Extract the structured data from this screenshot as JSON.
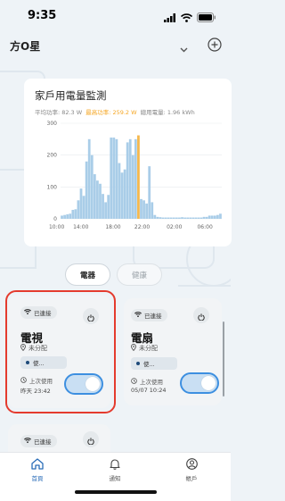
{
  "status_bar": {
    "time": "9:35"
  },
  "header": {
    "home_name": "方O星"
  },
  "chart_card": {
    "title": "家戶用電量監測",
    "avg_power_label": "平均功率:",
    "avg_power_value": "82.3 W",
    "peak_power_label": "最高功率:",
    "peak_power_value": "259.2 W",
    "total_label": "總用電量:",
    "total_value": "1.96 kWh"
  },
  "chart_data": {
    "type": "bar",
    "title": "家戶用電量監測",
    "xlabel": "",
    "ylabel": "",
    "ylim": [
      0,
      300
    ],
    "yticks": [
      "0",
      "100",
      "200",
      "300"
    ],
    "xticks": [
      "10:00",
      "14:00",
      "18:00",
      "22:00",
      "02:00",
      "06:00"
    ],
    "highlight_color": "#f5b84d",
    "bar_color": "#a9cde8",
    "highlight_index": 28,
    "values": [
      10,
      12,
      14,
      16,
      28,
      30,
      58,
      95,
      72,
      180,
      250,
      200,
      140,
      120,
      110,
      78,
      52,
      75,
      255,
      255,
      250,
      175,
      145,
      155,
      240,
      250,
      200,
      250,
      262,
      62,
      58,
      48,
      165,
      52,
      12,
      6,
      5,
      4,
      4,
      4,
      4,
      4,
      4,
      4,
      5,
      4,
      4,
      4,
      4,
      4,
      4,
      4,
      6,
      6,
      10,
      10,
      10,
      12,
      16
    ]
  },
  "tabs": {
    "electrical": "電器",
    "health": "健康"
  },
  "devices": [
    {
      "status": "已連接",
      "name": "電視",
      "room": "未分配",
      "mode": "使...",
      "last_used_label": "上次使用",
      "last_used": "昨天 23:42",
      "on": true
    },
    {
      "status": "已連接",
      "name": "電扇",
      "room": "未分配",
      "mode": "使...",
      "last_used_label": "上次使用",
      "last_used": "05/07 10:24",
      "on": true
    },
    {
      "status": "已連接"
    }
  ],
  "bottom_tabs": {
    "home": "首頁",
    "notifications": "通知",
    "account": "帳戶"
  },
  "colors": {
    "accent": "#2a6db8",
    "peak": "#f5a623",
    "highlight": "#e43b2e",
    "toggle": "#3d8fe0"
  },
  "icons": {
    "wifi": "wifi-icon",
    "battery": "battery-icon",
    "power": "power-icon",
    "location": "location-pin-icon",
    "clock": "clock-icon",
    "home": "home-icon",
    "bell": "bell-icon",
    "account": "account-icon",
    "plus": "plus-circle-icon",
    "chevron": "chevron-down-icon"
  }
}
